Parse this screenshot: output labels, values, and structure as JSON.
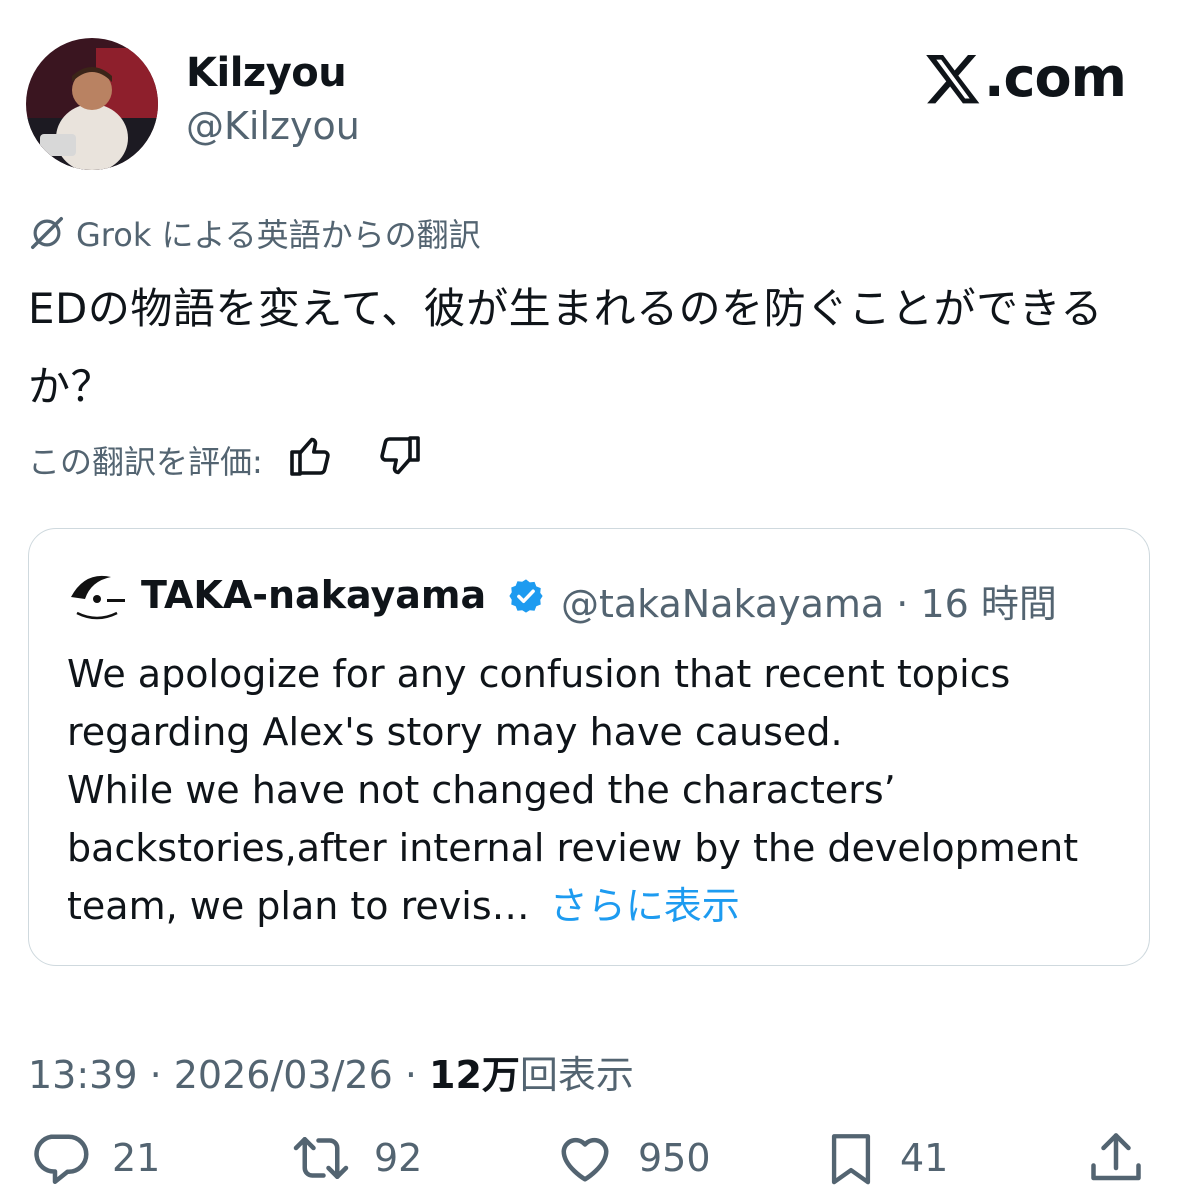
{
  "author": {
    "name": "Kilzyou",
    "handle": "@Kilzyou"
  },
  "brand": {
    "label": ".com",
    "icon": "x-logo-icon"
  },
  "translation": {
    "label": "Grok による英語からの翻訳",
    "text": "EDの物語を変えて、彼が生まれるのを防ぐことができるか？",
    "rate_label": "この翻訳を評価:"
  },
  "quote": {
    "name": "TAKA-nakayama",
    "handle_time": "@takaNakayama · 16 時間",
    "lines": [
      "We apologize for any confusion that recent topics regarding Alex's story may have caused.",
      "While we have not changed the characters’ backstories,after internal review by the development team, we plan to revis…"
    ],
    "show_more": "さらに表示"
  },
  "meta": {
    "time_date": "13:39 · 2026/03/26 · ",
    "views_count": "12万",
    "views_label": "回表示"
  },
  "stats": {
    "replies": "21",
    "reposts": "92",
    "likes": "950",
    "bookmarks": "41"
  },
  "colors": {
    "accent": "#1d9bf0",
    "secondary_text": "#536471",
    "border": "#cfd9de"
  }
}
